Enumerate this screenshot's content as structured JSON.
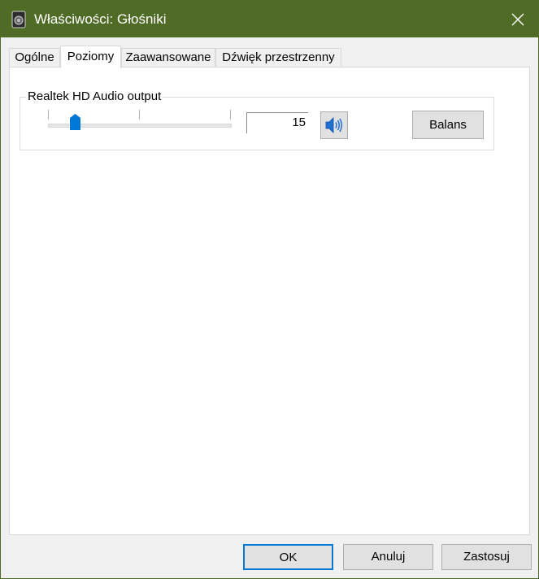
{
  "window": {
    "title": "Właściwości: Głośniki",
    "title_bar_color": "#4f6b25"
  },
  "tabs": [
    {
      "label": "Ogólne",
      "active": false
    },
    {
      "label": "Poziomy",
      "active": true
    },
    {
      "label": "Zaawansowane",
      "active": false
    },
    {
      "label": "Dźwięk przestrzenny",
      "active": false
    }
  ],
  "levels": {
    "device_label": "Realtek HD Audio output",
    "volume_value": "15",
    "volume_level_percent": 15,
    "speaker_icon": "speaker-volume-icon",
    "balance_label": "Balans"
  },
  "footer": {
    "ok_label": "OK",
    "cancel_label": "Anuluj",
    "apply_label": "Zastosuj"
  },
  "colors": {
    "accent": "#0078d7",
    "thumb": "#0078d7"
  }
}
